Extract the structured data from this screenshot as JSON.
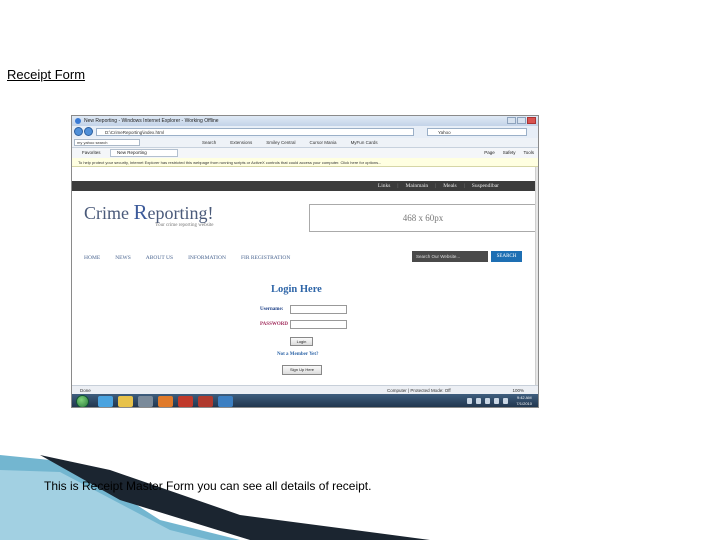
{
  "slide": {
    "title": "Receipt Form",
    "caption": "This is Receipt Master Form you can see all details of receipt."
  },
  "browser": {
    "window_title": "New Reporting - Windows Internet Explorer - Working Offline",
    "address": "D:\\CrimeReporting\\index.html",
    "search_engine": "Yahoo",
    "toolbar_field": "my yahoo search",
    "toolbar_items": [
      "Search",
      "Extensions",
      "Smiley Central",
      "Cursor Mania",
      "MyFun Cards"
    ],
    "favorites_label": "Favorites",
    "tab_label": "New Reporting",
    "tools_items": [
      "Page",
      "Safety",
      "Tools"
    ],
    "info_bar": "To help protect your security, Internet Explorer has restricted this webpage from running scripts or ActiveX controls that could access your computer. Click here for options...",
    "status_done": "Done",
    "status_zone": "Computer | Protected Mode: Off",
    "zoom": "100%",
    "clock_time": "9:42 AM",
    "clock_date": "7/1/2010"
  },
  "site": {
    "top_links": [
      "Links",
      "Mainmain",
      "Meals",
      "Suspendlbar"
    ],
    "logo_prefix": "Crime ",
    "logo_r": "R",
    "logo_rest": "eporting!",
    "tagline": "Your crime reporting website",
    "ad_text": "468 x 60px",
    "menu": [
      "HOME",
      "NEWS",
      "ABOUT US",
      "INFORMATION",
      "FIR REGISTRATION"
    ],
    "site_search_placeholder": "Search Our Website...",
    "site_search_button": "SEARCH",
    "login_title": "Login Here",
    "username_label": "Username:",
    "password_label": "PASSWORD",
    "login_button": "Login",
    "member_link": "Not a Member Yet?",
    "signup_button": "Sign Up Here"
  },
  "colors": {
    "link_blue": "#2f66a8",
    "search_button": "#1e6fb3",
    "top_strip": "#3b3b3b"
  }
}
